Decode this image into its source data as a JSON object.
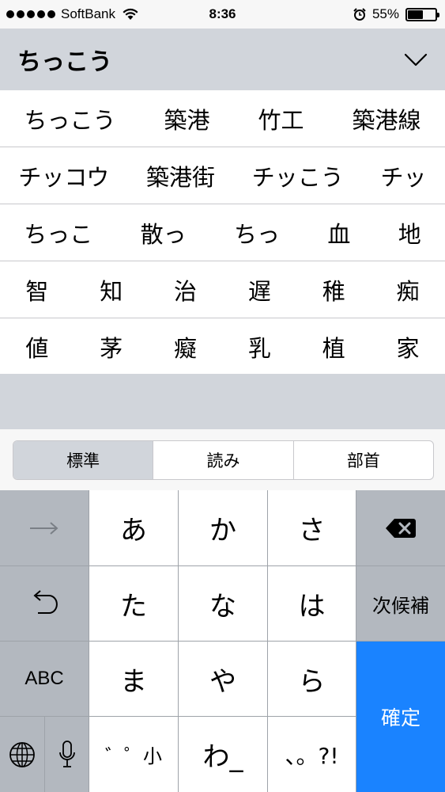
{
  "status_bar": {
    "carrier": "SoftBank",
    "time": "8:36",
    "battery_percent_label": "55%",
    "battery_level": 0.55
  },
  "composition": {
    "text": "ちっこう"
  },
  "candidates": [
    [
      "ちっこう",
      "築港",
      "竹工",
      "築港線"
    ],
    [
      "チッコウ",
      "築港街",
      "チッこう",
      "チッ"
    ],
    [
      "ちっこ",
      "散っ",
      "ちっ",
      "血",
      "地"
    ],
    [
      "智",
      "知",
      "治",
      "遅",
      "稚",
      "痴"
    ],
    [
      "値",
      "茅",
      "癡",
      "乳",
      "植",
      "家"
    ]
  ],
  "segments": {
    "standard": "標準",
    "reading": "読み",
    "radical": "部首"
  },
  "keyboard": {
    "a": "あ",
    "ka": "か",
    "sa": "さ",
    "ta": "た",
    "na": "な",
    "ha": "は",
    "ma": "ま",
    "ya": "や",
    "ra": "ら",
    "dakuten": "゛゜小",
    "wa": "わ_",
    "punct": "、。?!",
    "next_candidate": "次候補",
    "confirm": "確定",
    "abc": "ABC"
  },
  "colors": {
    "accent": "#1a83ff",
    "keyboard_dark": "#b3b8bf",
    "panel": "#d1d5db"
  }
}
